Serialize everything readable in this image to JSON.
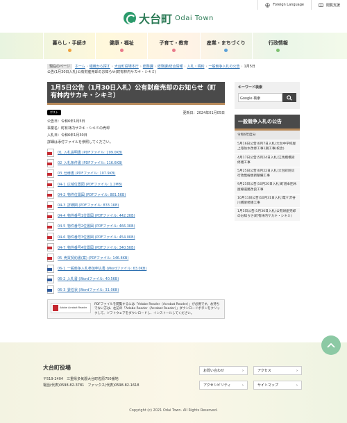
{
  "util": {
    "lang": "Foreign Language",
    "read": "閲覧支援"
  },
  "logo": {
    "jp": "大台町",
    "en": "Odai Town"
  },
  "nav": [
    {
      "label": "暮らし・手続き",
      "color": "#f0a03c"
    },
    {
      "label": "健康・福祉",
      "color": "#e87a8a"
    },
    {
      "label": "子育て・教育",
      "color": "#e87a8a"
    },
    {
      "label": "産業・まちづくり",
      "color": "#5aa0d8"
    },
    {
      "label": "行政情報",
      "color": "#7cc070"
    }
  ],
  "crumb": {
    "label": "現在のページ",
    "items": [
      "ホーム",
      "組織から探す",
      "大台町役場本庁",
      "総務課",
      "総務課/総合情報",
      "入札・契約",
      "一般競争入札の公告"
    ],
    "current": "1月5日公告(1月30日入札)公有財産売却のお知らせ(町有林内サカキ・シキミ)"
  },
  "page": {
    "title": "1月5日公告（1月30日入札）公有財産売却のお知らせ（町有林内サカキ・シキミ）",
    "tweet": "ポスト",
    "updated": "更新日：2024年01月05日",
    "lines": [
      "公告日：令和6年1月5日",
      "事業名：町有林内サカキ・シキミの売却",
      "入札日：令和6年1月30日",
      "詳細は添付ファイルを参照してください。"
    ]
  },
  "files": [
    {
      "type": "pdf",
      "text": "01_入札説明書 (PDFファイル: 209.0KB)"
    },
    {
      "type": "pdf",
      "text": "02_入札条件書 (PDFファイル: 116.6KB)"
    },
    {
      "type": "pdf",
      "text": "03_仕様書 (PDFファイル: 107.9KB)"
    },
    {
      "type": "pdf",
      "text": "04-1_広域位置図 (PDFファイル: 1.2MB)"
    },
    {
      "type": "pdf",
      "text": "04-2_物件位置図 (PDFファイル: 881.5KB)"
    },
    {
      "type": "pdf",
      "text": "04-3_詳細図 (PDFファイル: 833.1KB)"
    },
    {
      "type": "pdf",
      "text": "04-4_物件番号1位置図 (PDFファイル: 442.2KB)"
    },
    {
      "type": "pdf",
      "text": "04-5_物件番号2位置図 (PDFファイル: 466.3KB)"
    },
    {
      "type": "pdf",
      "text": "04-6_物件番号3位置図 (PDFファイル: 454.0KB)"
    },
    {
      "type": "pdf",
      "text": "04-7_物件番号4位置図 (PDFファイル: 340.5KB)"
    },
    {
      "type": "pdf",
      "text": "05_売買契約書(案) (PDFファイル: 146.8KB)"
    },
    {
      "type": "word",
      "text": "06-1_一般競争入札参加申込書 (Wordファイル: 63.0KB)"
    },
    {
      "type": "word",
      "text": "06-2_入札書 (Wordファイル: 40.5KB)"
    },
    {
      "type": "word",
      "text": "06-3_委任状 (Wordファイル: 31.0KB)"
    }
  ],
  "reader": {
    "badge": "Adobe Acrobat Reader",
    "text": "PDFファイルを閲覧するには「Adobe Reader（Acrobat Reader）」が必要です。お持ちでない方は、左記の「Adobe Reader（Acrobat Reader）」ダウンロードボタンをクリックして、ソフトウェアをダウンロードし、インストールしてください。"
  },
  "side": {
    "search_title": "キーワード検索",
    "search_placeholder": "Google 検索",
    "list_title": "一般競争入札の公告",
    "list_head": "令和6年度分",
    "items": [
      "5月16日公告(6月7日入札)大台中学校屋上等防水改修工事1期工事(校舎)",
      "4月17日公告(5月24日入札)江馬橋橋梁修繕工事",
      "5月25日公告(6月22日入札)大台町防災行政無線更新整備工事",
      "9月25日公告(10月20日入札)町道本田木屋線道路改良工事",
      "10月11日公告(10月31日入札)篭ケ沢谷川橋梁修繕工事",
      "1月5日公告(1月30日入札)公有財産売却のお知らせ(町有林内サカキ・シキミ)"
    ]
  },
  "footer": {
    "name": "大台町役場",
    "addr1": "〒519-2404　三重県多気郡大台町佐原750番地",
    "addr2": "電話(代表)0598-82-3781　ファックス(代表)0598-82-1618",
    "btns": [
      "お問い合わせ",
      "アクセス",
      "アクセシビリティ",
      "サイトマップ"
    ],
    "copy": "Copyright (c) 2021 Odai Town. All Rights Reserved."
  }
}
